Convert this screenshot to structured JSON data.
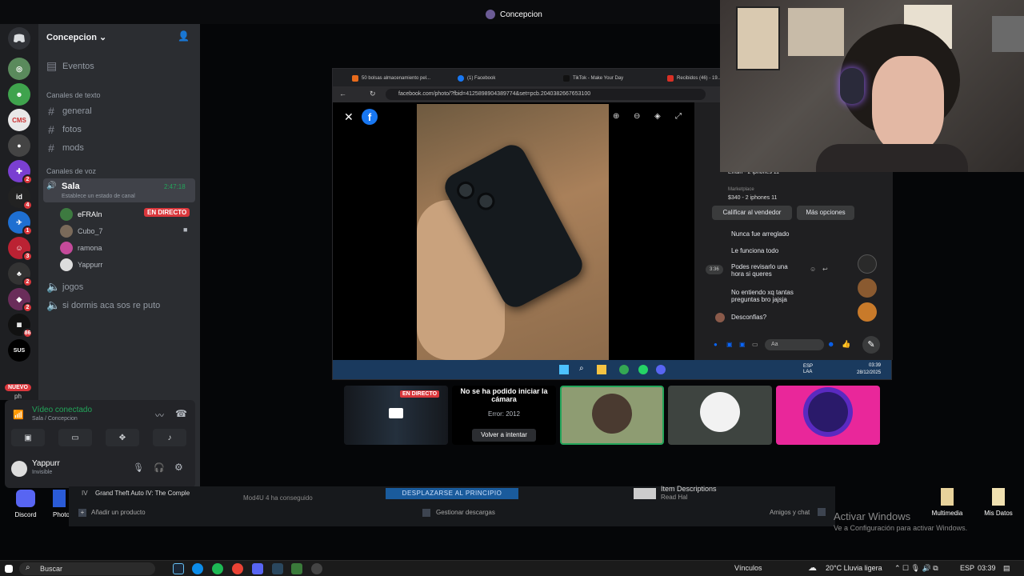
{
  "title_bar": {
    "label": "Concepcion"
  },
  "server_rail": {
    "badges": [
      "2",
      "4",
      "1",
      "3",
      "2",
      "2",
      "86"
    ],
    "nuevo_label": "NUEVO",
    "partial_label": "ph"
  },
  "sidebar": {
    "server_name": "Concepcion",
    "text_category": "Canales de texto",
    "text_channels": [
      "general",
      "fotos",
      "mods"
    ],
    "voice_category": "Canales de voz",
    "active_voice": {
      "name": "Sala",
      "status": "Establece un estado de canal",
      "timer": "2:47:18"
    },
    "voice_users": [
      "eFRAIn",
      "Cubo_7",
      "ramona",
      "Yappurr"
    ],
    "live_badge": "EN DIRECTO",
    "other_voice": [
      "jogos",
      "si dormis aca sos re puto"
    ]
  },
  "voice_panel": {
    "status": "Vídeo conectado",
    "location": "Sala / Concepcion",
    "username": "Yappurr",
    "user_status": "Invisible"
  },
  "browser": {
    "tabs": [
      "50 bolsas almacenamiento pel...",
      "(1) Facebook",
      "TikTok - Make Your Day",
      "Recibidos (46) - 19..."
    ],
    "url": "facebook.com/photo/?fbid=4125898904389774&set=pcb.2040382667653100",
    "messenger": {
      "header_name": "Efrain - 2 iphones 11",
      "header_sub": "Marketplace",
      "listing": "$340 - 2 iphones 11",
      "rate_button": "Calificar al vendedor",
      "more_button": "Más opciones",
      "messages": [
        "Nunca fue arreglado",
        "Le funciona todo",
        "Podes revisarlo una hora si queres",
        "No entiendo xq tantas preguntas bro jajsja",
        "Desconfias?"
      ],
      "time": "3:36",
      "input_placeholder": "Aa"
    },
    "inner_taskbar": {
      "lang": "ESP LAA",
      "time": "03:39",
      "date": "28/12/2025"
    }
  },
  "stream_tiles": {
    "live_badge": "EN DIRECTO",
    "camera_error_title": "No se ha podido iniciar la cámara",
    "camera_error_code": "Error: 2012",
    "retry_button": "Volver a intentar"
  },
  "footer": {
    "desktop_discord": "Discord",
    "desktop_photo": "Photo",
    "game_item": "Grand Theft Auto IV: The Comple",
    "scroll_button": "DESPLAZARSE AL PRINCIPIO",
    "partial_item": "Mod4U 4 ha conseguido",
    "item_desc": "Item Descriptions",
    "item_desc_sub": "Read Hal",
    "add_product": "Añadir un producto",
    "manage_downloads": "Gestionar descargas",
    "friends_chat": "Amigos y chat"
  },
  "desktop": {
    "activate_title": "Activar Windows",
    "activate_sub": "Ve a Configuración para activar Windows.",
    "icons": [
      "Multimedia",
      "Mis Datos"
    ]
  },
  "taskbar": {
    "search_label": "Buscar",
    "links_label": "Vínculos",
    "weather": "20°C  Lluvia ligera",
    "lang": "ESP",
    "time": "03:39"
  }
}
